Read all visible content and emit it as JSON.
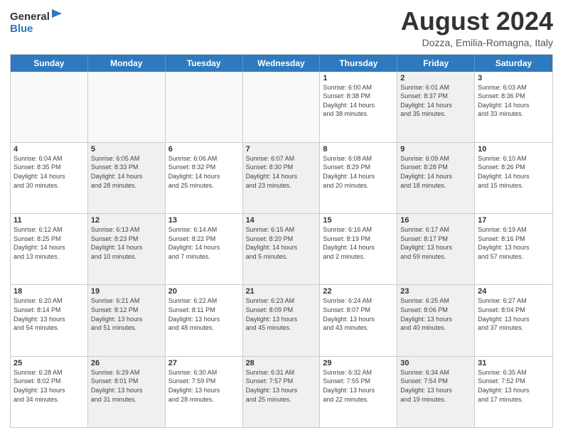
{
  "logo": {
    "line1": "General",
    "line2": "Blue"
  },
  "title": "August 2024",
  "subtitle": "Dozza, Emilia-Romagna, Italy",
  "days": [
    "Sunday",
    "Monday",
    "Tuesday",
    "Wednesday",
    "Thursday",
    "Friday",
    "Saturday"
  ],
  "weeks": [
    [
      {
        "day": "",
        "text": "",
        "empty": true
      },
      {
        "day": "",
        "text": "",
        "empty": true
      },
      {
        "day": "",
        "text": "",
        "empty": true
      },
      {
        "day": "",
        "text": "",
        "empty": true
      },
      {
        "day": "1",
        "text": "Sunrise: 6:00 AM\nSunset: 8:38 PM\nDaylight: 14 hours\nand 38 minutes.",
        "shaded": false
      },
      {
        "day": "2",
        "text": "Sunrise: 6:01 AM\nSunset: 8:37 PM\nDaylight: 14 hours\nand 35 minutes.",
        "shaded": true
      },
      {
        "day": "3",
        "text": "Sunrise: 6:03 AM\nSunset: 8:36 PM\nDaylight: 14 hours\nand 33 minutes.",
        "shaded": false
      }
    ],
    [
      {
        "day": "4",
        "text": "Sunrise: 6:04 AM\nSunset: 8:35 PM\nDaylight: 14 hours\nand 30 minutes.",
        "shaded": false
      },
      {
        "day": "5",
        "text": "Sunrise: 6:05 AM\nSunset: 8:33 PM\nDaylight: 14 hours\nand 28 minutes.",
        "shaded": true
      },
      {
        "day": "6",
        "text": "Sunrise: 6:06 AM\nSunset: 8:32 PM\nDaylight: 14 hours\nand 25 minutes.",
        "shaded": false
      },
      {
        "day": "7",
        "text": "Sunrise: 6:07 AM\nSunset: 8:30 PM\nDaylight: 14 hours\nand 23 minutes.",
        "shaded": true
      },
      {
        "day": "8",
        "text": "Sunrise: 6:08 AM\nSunset: 8:29 PM\nDaylight: 14 hours\nand 20 minutes.",
        "shaded": false
      },
      {
        "day": "9",
        "text": "Sunrise: 6:09 AM\nSunset: 8:28 PM\nDaylight: 14 hours\nand 18 minutes.",
        "shaded": true
      },
      {
        "day": "10",
        "text": "Sunrise: 6:10 AM\nSunset: 8:26 PM\nDaylight: 14 hours\nand 15 minutes.",
        "shaded": false
      }
    ],
    [
      {
        "day": "11",
        "text": "Sunrise: 6:12 AM\nSunset: 8:25 PM\nDaylight: 14 hours\nand 13 minutes.",
        "shaded": false
      },
      {
        "day": "12",
        "text": "Sunrise: 6:13 AM\nSunset: 8:23 PM\nDaylight: 14 hours\nand 10 minutes.",
        "shaded": true
      },
      {
        "day": "13",
        "text": "Sunrise: 6:14 AM\nSunset: 8:22 PM\nDaylight: 14 hours\nand 7 minutes.",
        "shaded": false
      },
      {
        "day": "14",
        "text": "Sunrise: 6:15 AM\nSunset: 8:20 PM\nDaylight: 14 hours\nand 5 minutes.",
        "shaded": true
      },
      {
        "day": "15",
        "text": "Sunrise: 6:16 AM\nSunset: 8:19 PM\nDaylight: 14 hours\nand 2 minutes.",
        "shaded": false
      },
      {
        "day": "16",
        "text": "Sunrise: 6:17 AM\nSunset: 8:17 PM\nDaylight: 13 hours\nand 59 minutes.",
        "shaded": true
      },
      {
        "day": "17",
        "text": "Sunrise: 6:19 AM\nSunset: 8:16 PM\nDaylight: 13 hours\nand 57 minutes.",
        "shaded": false
      }
    ],
    [
      {
        "day": "18",
        "text": "Sunrise: 6:20 AM\nSunset: 8:14 PM\nDaylight: 13 hours\nand 54 minutes.",
        "shaded": false
      },
      {
        "day": "19",
        "text": "Sunrise: 6:21 AM\nSunset: 8:12 PM\nDaylight: 13 hours\nand 51 minutes.",
        "shaded": true
      },
      {
        "day": "20",
        "text": "Sunrise: 6:22 AM\nSunset: 8:11 PM\nDaylight: 13 hours\nand 48 minutes.",
        "shaded": false
      },
      {
        "day": "21",
        "text": "Sunrise: 6:23 AM\nSunset: 8:09 PM\nDaylight: 13 hours\nand 45 minutes.",
        "shaded": true
      },
      {
        "day": "22",
        "text": "Sunrise: 6:24 AM\nSunset: 8:07 PM\nDaylight: 13 hours\nand 43 minutes.",
        "shaded": false
      },
      {
        "day": "23",
        "text": "Sunrise: 6:25 AM\nSunset: 8:06 PM\nDaylight: 13 hours\nand 40 minutes.",
        "shaded": true
      },
      {
        "day": "24",
        "text": "Sunrise: 6:27 AM\nSunset: 8:04 PM\nDaylight: 13 hours\nand 37 minutes.",
        "shaded": false
      }
    ],
    [
      {
        "day": "25",
        "text": "Sunrise: 6:28 AM\nSunset: 8:02 PM\nDaylight: 13 hours\nand 34 minutes.",
        "shaded": false
      },
      {
        "day": "26",
        "text": "Sunrise: 6:29 AM\nSunset: 8:01 PM\nDaylight: 13 hours\nand 31 minutes.",
        "shaded": true
      },
      {
        "day": "27",
        "text": "Sunrise: 6:30 AM\nSunset: 7:59 PM\nDaylight: 13 hours\nand 28 minutes.",
        "shaded": false
      },
      {
        "day": "28",
        "text": "Sunrise: 6:31 AM\nSunset: 7:57 PM\nDaylight: 13 hours\nand 25 minutes.",
        "shaded": true
      },
      {
        "day": "29",
        "text": "Sunrise: 6:32 AM\nSunset: 7:55 PM\nDaylight: 13 hours\nand 22 minutes.",
        "shaded": false
      },
      {
        "day": "30",
        "text": "Sunrise: 6:34 AM\nSunset: 7:54 PM\nDaylight: 13 hours\nand 19 minutes.",
        "shaded": true
      },
      {
        "day": "31",
        "text": "Sunrise: 6:35 AM\nSunset: 7:52 PM\nDaylight: 13 hours\nand 17 minutes.",
        "shaded": false
      }
    ]
  ]
}
